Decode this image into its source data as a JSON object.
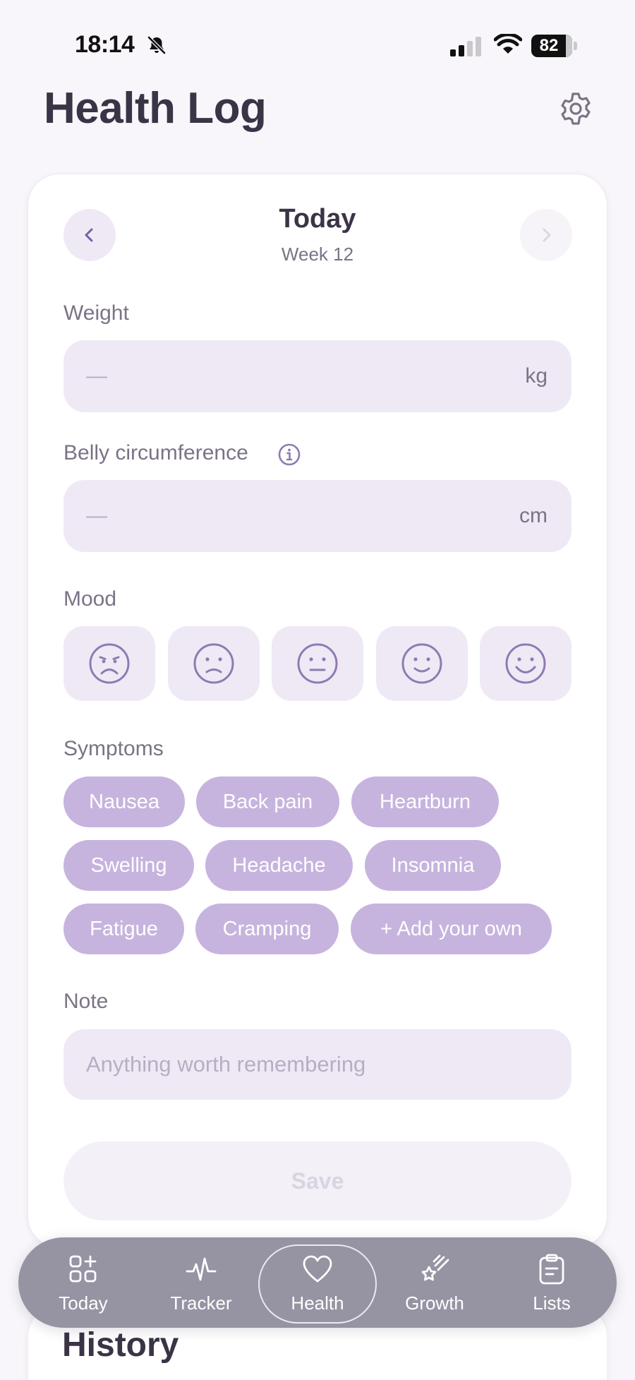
{
  "status_bar": {
    "time": "18:14",
    "battery": "82",
    "icons": [
      "bell-slash-icon",
      "cellular-signal-icon",
      "wifi-icon",
      "battery-icon"
    ]
  },
  "header": {
    "title": "Health Log",
    "settings_icon": "gear-icon"
  },
  "day_nav": {
    "title": "Today",
    "subtitle": "Week 12"
  },
  "weight": {
    "label": "Weight",
    "placeholder": "—",
    "unit": "kg"
  },
  "belly": {
    "label": "Belly circumference",
    "placeholder": "—",
    "unit": "cm"
  },
  "mood": {
    "label": "Mood",
    "options": [
      "very-sad-face-icon",
      "sad-face-icon",
      "neutral-face-icon",
      "happy-face-icon",
      "very-happy-face-icon"
    ]
  },
  "symptoms": {
    "label": "Symptoms",
    "chips": [
      "Nausea",
      "Back pain",
      "Heartburn",
      "Swelling",
      "Headache",
      "Insomnia",
      "Fatigue",
      "Cramping",
      "+ Add your own"
    ]
  },
  "note": {
    "label": "Note",
    "placeholder": "Anything worth remembering"
  },
  "save_label": "Save",
  "history": {
    "title": "History"
  },
  "tabs": [
    {
      "label": "Today",
      "icon": "dashboard-icon"
    },
    {
      "label": "Tracker",
      "icon": "pulse-icon"
    },
    {
      "label": "Health",
      "icon": "heart-icon",
      "active": true
    },
    {
      "label": "Growth",
      "icon": "shooting-star-icon"
    },
    {
      "label": "Lists",
      "icon": "clipboard-icon"
    }
  ],
  "colors": {
    "accent": "#c6b4de",
    "input_bg": "#efe9f6",
    "tab_bar": "#9693a3",
    "text": "#3b3346"
  }
}
